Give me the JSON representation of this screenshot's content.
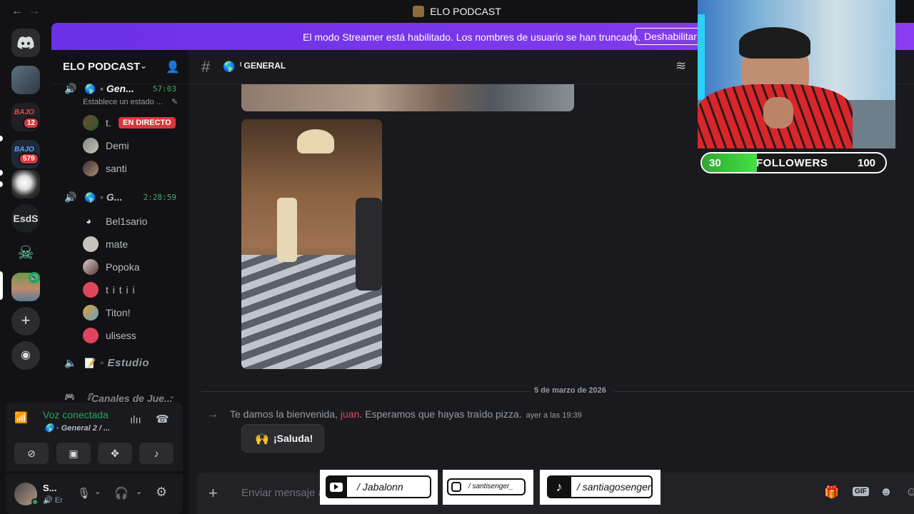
{
  "window": {
    "title": "ELO PODCAST",
    "back": "←",
    "forward": "→"
  },
  "rail": {
    "servers": [
      {
        "name": "server-1"
      },
      {
        "name": "server-bajo-1",
        "badge": "12"
      },
      {
        "name": "server-bajo-2",
        "badge": "579"
      },
      {
        "name": "server-3"
      },
      {
        "name": "EsdS",
        "label": "EsdS"
      },
      {
        "name": "server-5"
      },
      {
        "name": "server-6"
      }
    ],
    "add": "+",
    "discover": "⌖"
  },
  "banner": {
    "text": "El modo Streamer está habilitado. Los nombres de usuario se han truncado.",
    "button": "Deshabilitar"
  },
  "guild": {
    "name": "ELO PODCAST"
  },
  "voice_channels": [
    {
      "name": "◦ Gen...",
      "time": "57:03",
      "status": "Establece un estado ...",
      "members": [
        {
          "name": "t.",
          "live": "EN DIRECTO"
        },
        {
          "name": "Demi"
        },
        {
          "name": "santi"
        }
      ]
    },
    {
      "name": "◦ G...",
      "time": "2:28:59",
      "members": [
        {
          "name": "Bel1sario"
        },
        {
          "name": "mate"
        },
        {
          "name": "Popoka"
        },
        {
          "name": "t i t i i"
        },
        {
          "name": "Titon!"
        },
        {
          "name": "ulisess"
        }
      ]
    },
    {
      "name": "◦ Estudio"
    }
  ],
  "category": {
    "name": "『Canales de Jue..."
  },
  "voice_panel": {
    "status": "Voz conectada",
    "channel": "◦ General 2 / ..."
  },
  "user_panel": {
    "name": "S...",
    "sub": "Er"
  },
  "channel": {
    "name": "GENERAL",
    "prefix": "ᴵ"
  },
  "chat": {
    "date": "5 de marzo de 2026",
    "join_prefix": "Te damos la bienvenida, ",
    "join_user": "juan",
    "join_suffix": ". Esperamos que hayas traído pizza.",
    "join_time": "ayer a las 19:39",
    "wave_button": "¡Saluda!",
    "composer_placeholder": "Enviar mensaje a"
  },
  "overlay": {
    "followers_current": "30",
    "followers_label": "FOLLOWERS",
    "followers_goal": "100",
    "followers_progress": 0.3,
    "socials": [
      {
        "platform": "youtube",
        "handle": "/  Jabalonn"
      },
      {
        "platform": "instagram",
        "handle": "/   santisenger_"
      },
      {
        "platform": "tiktok",
        "handle": "/ santiagosenger"
      }
    ]
  },
  "colors": {
    "banner": "#6a31e6",
    "live_badge": "#da373c",
    "voice_green": "#4ea36a",
    "join_user": "#e0455e",
    "followers_bar": "#3fd03f"
  }
}
